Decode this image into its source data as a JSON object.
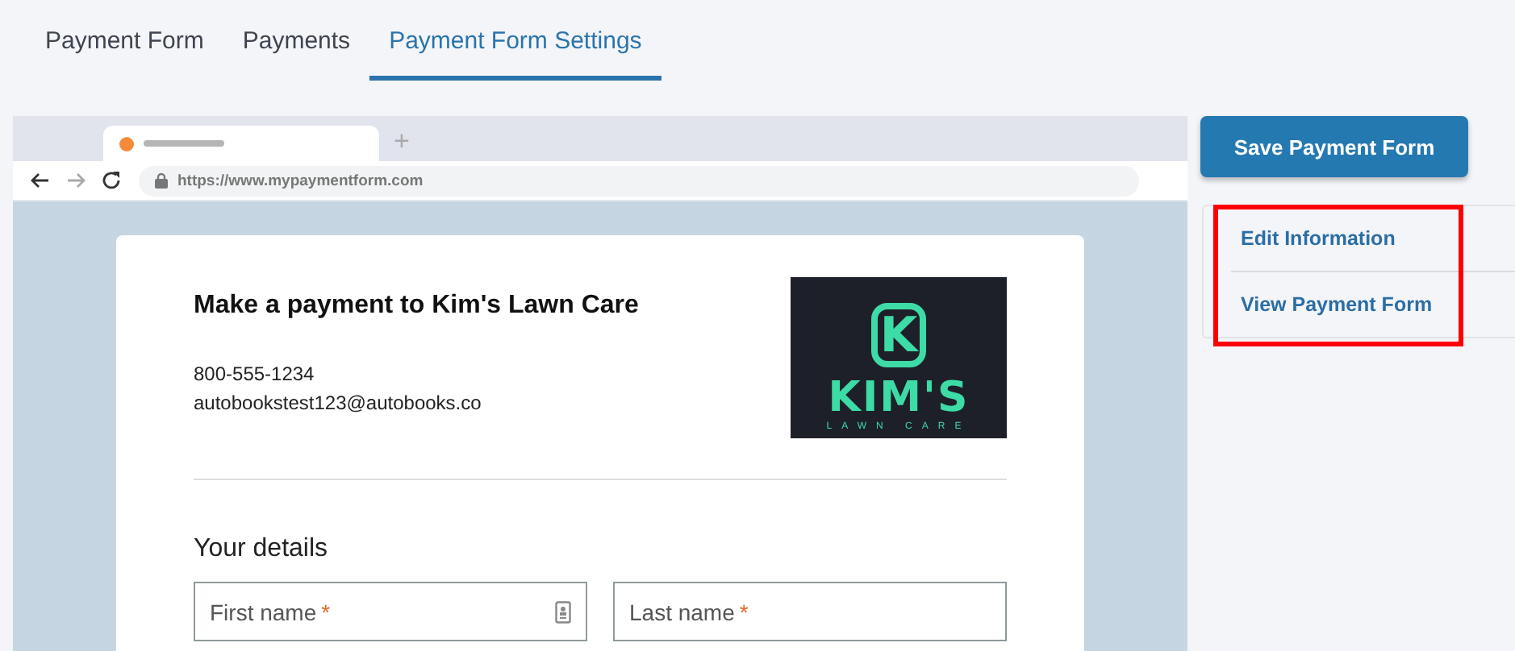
{
  "tabs": [
    {
      "label": "Payment Form",
      "selected": false
    },
    {
      "label": "Payments",
      "selected": false
    },
    {
      "label": "Payment Form Settings",
      "selected": true
    }
  ],
  "preview": {
    "browser": {
      "new_tab": "+",
      "url": "https://www.mypaymentform.com"
    },
    "form": {
      "title": "Make a payment to Kim's Lawn Care",
      "phone": "800-555-1234",
      "email": "autobookstest123@autobooks.co",
      "logo": {
        "monogram": "K",
        "name": "KIM'S",
        "tagline": "LAWN CARE"
      },
      "section": "Your details",
      "fields": [
        {
          "placeholder": "First name",
          "required_mark": "*",
          "kind": "contact"
        },
        {
          "placeholder": "Last name",
          "required_mark": "*",
          "kind": "plain"
        }
      ]
    }
  },
  "save_button": "Save Payment Form",
  "side_menu": {
    "highlighted": true,
    "items": [
      "Edit Information",
      "View Payment Form"
    ]
  }
}
